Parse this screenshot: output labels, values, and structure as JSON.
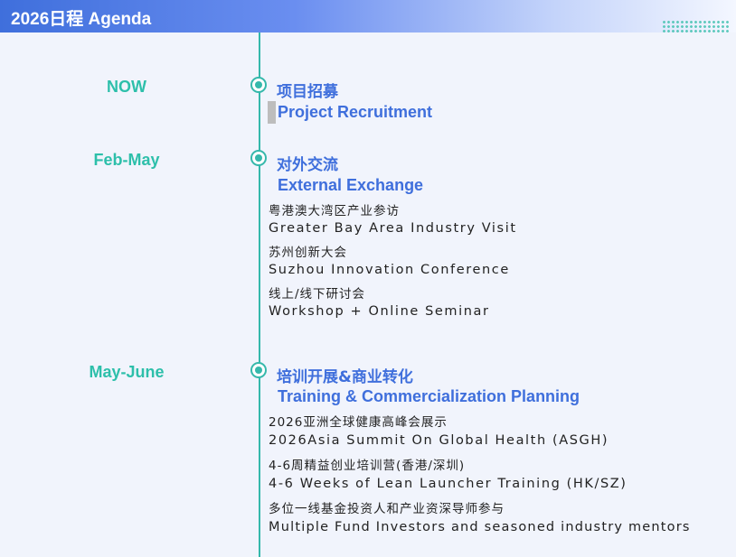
{
  "header": {
    "title": "2026日程 Agenda"
  },
  "accent_colors": {
    "blue": "#3f6fdc",
    "teal": "#35b8ab",
    "period_text": "#2dbfaa"
  },
  "milestones": [
    {
      "period": "NOW",
      "title_cn": "项目招募",
      "title_en": "Project Recruitment",
      "details": []
    },
    {
      "period": "Feb-May",
      "title_cn": "对外交流",
      "title_en": "External Exchange",
      "details": [
        "粤港澳大湾区产业参访",
        "Greater Bay Area Industry Visit",
        "苏州创新大会",
        "Suzhou Innovation Conference",
        "线上/线下研讨会",
        "Workshop + Online Seminar"
      ]
    },
    {
      "period": "May-June",
      "title_cn": "培训开展&商业转化",
      "title_en": "Training & Commercialization Planning",
      "details": [
        "2026亚洲全球健康高峰会展示",
        "2026Asia Summit On Global Health (ASGH)",
        "4-6周精益创业培训营(香港/深圳)",
        "4-6 Weeks of Lean Launcher Training (HK/SZ)",
        "多位一线基金投资人和产业资深导师参与",
        "Multiple Fund Investors and seasoned industry mentors"
      ]
    }
  ]
}
